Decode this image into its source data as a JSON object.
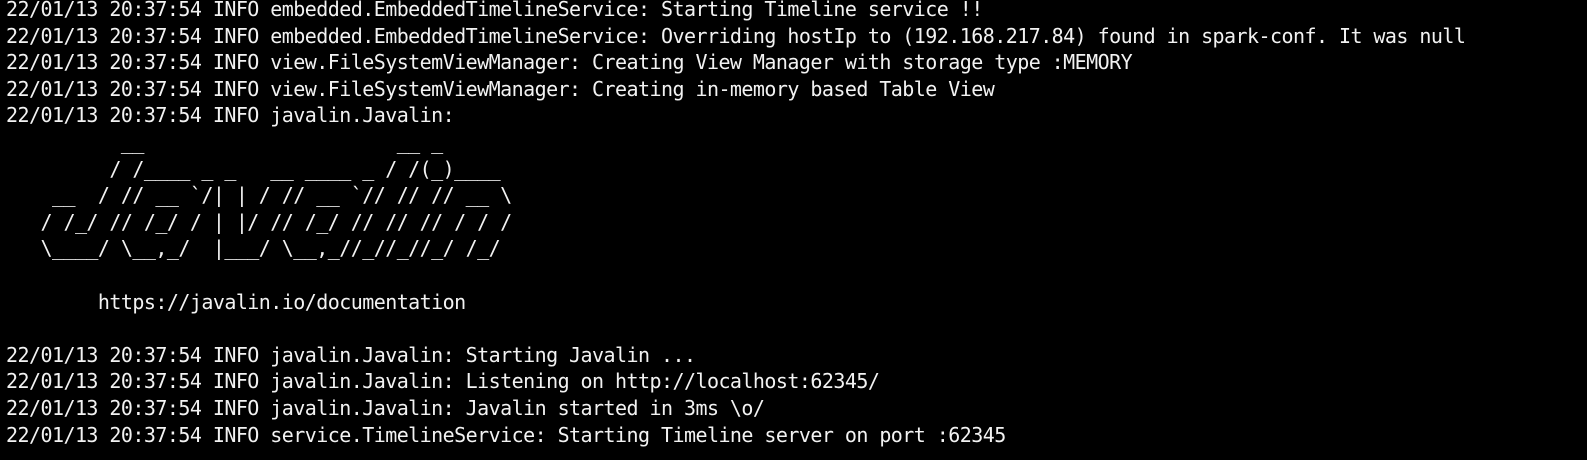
{
  "terminal": {
    "background": "#000000",
    "foreground": "#f2f2f2",
    "lines": [
      "22/01/13 20:37:54 INFO embedded.EmbeddedTimelineService: Starting Timeline service !!",
      "22/01/13 20:37:54 INFO embedded.EmbeddedTimelineService: Overriding hostIp to (192.168.217.84) found in spark-conf. It was null",
      "22/01/13 20:37:54 INFO view.FileSystemViewManager: Creating View Manager with storage type :MEMORY",
      "22/01/13 20:37:54 INFO view.FileSystemViewManager: Creating in-memory based Table View",
      "22/01/13 20:37:54 INFO javalin.Javalin:",
      "          __                      __ _",
      "         / /____ _ _   __ ____ _ / /(_)____",
      "    __  / // __ `/| | / // __ `// // // __ \\",
      "   / /_/ // /_/ / | |/ // /_/ // // // / / /",
      "   \\____/ \\__,_/  |___/ \\__,_//_//_//_/ /_/",
      "",
      "        https://javalin.io/documentation",
      "",
      "22/01/13 20:37:54 INFO javalin.Javalin: Starting Javalin ...",
      "22/01/13 20:37:54 INFO javalin.Javalin: Listening on http://localhost:62345/",
      "22/01/13 20:37:54 INFO javalin.Javalin: Javalin started in 3ms \\o/",
      "22/01/13 20:37:54 INFO service.TimelineService: Starting Timeline server on port :62345"
    ]
  }
}
